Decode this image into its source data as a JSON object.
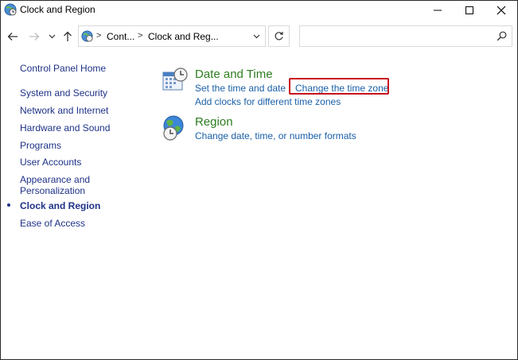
{
  "window": {
    "title": "Clock and Region",
    "title_icon": "clock-globe-icon"
  },
  "nav": {
    "back_icon": "arrow-left-icon",
    "forward_icon": "arrow-right-icon",
    "recent_icon": "chevron-down-icon",
    "up_icon": "arrow-up-icon"
  },
  "address": {
    "crumbs": [
      "Cont...",
      "Clock and Reg..."
    ],
    "separator": ">",
    "search_placeholder": ""
  },
  "sidebar": {
    "items": [
      {
        "label": "Control Panel Home"
      },
      {
        "label": "System and Security"
      },
      {
        "label": "Network and Internet"
      },
      {
        "label": "Hardware and Sound"
      },
      {
        "label": "Programs"
      },
      {
        "label": "User Accounts"
      },
      {
        "label": "Appearance and",
        "label2": "Personalization"
      },
      {
        "label": "Clock and Region"
      },
      {
        "label": "Ease of Access"
      }
    ],
    "current_index": 7
  },
  "categories": [
    {
      "title": "Date and Time",
      "icon": "calendar-clock-icon",
      "links": [
        "Set the time and date",
        "Change the time zone",
        "Add clocks for different time zones"
      ]
    },
    {
      "title": "Region",
      "icon": "globe-clock-icon",
      "links": [
        "Change date, time, or number formats"
      ]
    }
  ],
  "colors": {
    "category_title": "#2d7d1f",
    "task_link": "#1a5fa8",
    "nav_link": "#1e3287",
    "highlight_box": "#c8101e"
  }
}
